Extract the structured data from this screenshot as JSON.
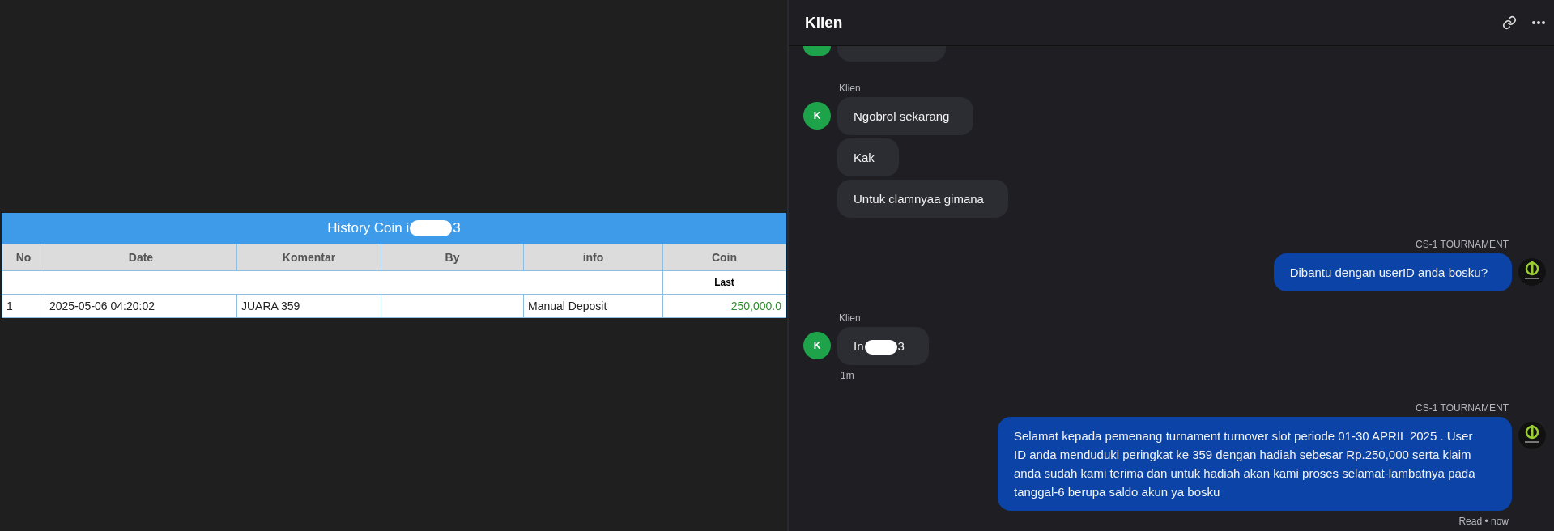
{
  "table": {
    "title_parts": [
      "History Coin i",
      "3"
    ],
    "columns": [
      "No",
      "Date",
      "Komentar",
      "By",
      "info",
      "Coin"
    ],
    "subheader": "Last",
    "rows": [
      {
        "cells": [
          "1",
          "2025-05-06 04:20:02",
          "JUARA 359",
          null,
          "Manual Deposit",
          "250,000.0"
        ]
      }
    ]
  },
  "chat": {
    "title": "Klien",
    "groups": [
      {
        "kind": "clipped"
      },
      {
        "kind": "incoming",
        "sender": "Klien",
        "avatar": "K",
        "bubbles": [
          {
            "text": "Ngobrol sekarang"
          },
          {
            "text": "Kak"
          },
          {
            "text": "Untuk clamnyaa gimana"
          }
        ]
      },
      {
        "kind": "outgoing",
        "sender": "CS-1 TOURNAMENT",
        "bubbles": [
          {
            "text": "Dibantu dengan userID anda bosku?"
          }
        ]
      },
      {
        "kind": "incoming",
        "sender": "Klien",
        "avatar": "K",
        "bubbles": [
          {
            "parts": [
              "In",
              "3"
            ]
          }
        ],
        "time": "1m"
      },
      {
        "kind": "outgoing",
        "sender": "CS-1 TOURNAMENT",
        "bubbles": [
          {
            "text": "Selamat kepada pemenang turnament turnover slot periode 01-30 APRIL 2025 . User ID anda menduduki peringkat ke 359 dengan hadiah sebesar Rp.250,000 serta klaim anda sudah kami terima dan untuk hadiah akan kami proses selamat-lambatnya pada tanggal-6 berupa saldo akun ya bosku"
          }
        ],
        "status": "Read",
        "separator": "•",
        "time": "now"
      }
    ]
  }
}
